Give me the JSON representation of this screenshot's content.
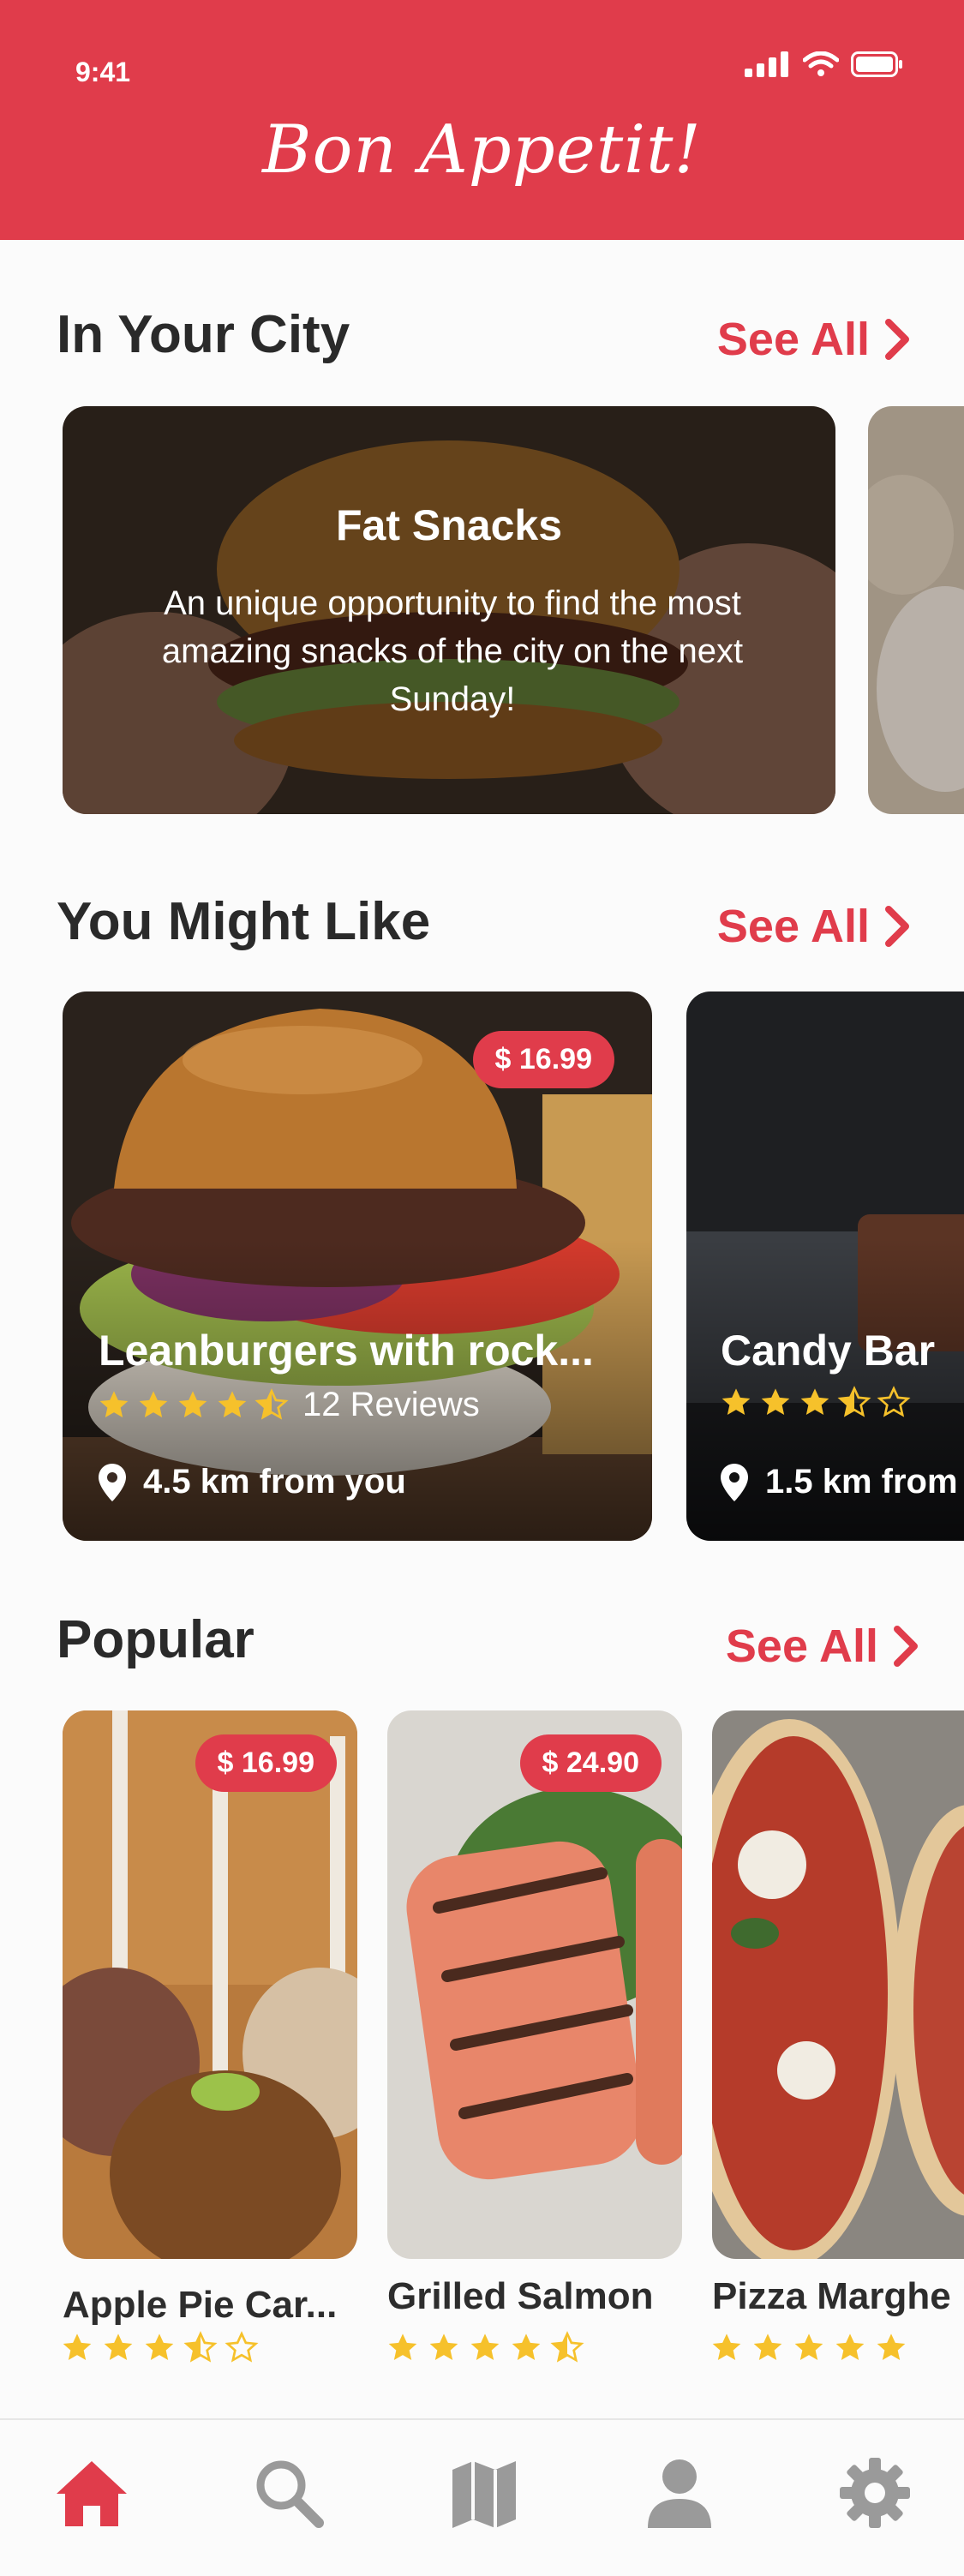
{
  "status": {
    "time": "9:41"
  },
  "app": {
    "brand": "Bon Appetit!",
    "accent": "#e03c4b"
  },
  "sections": {
    "city": {
      "title": "In Your City",
      "see_all": "See All"
    },
    "like": {
      "title": "You Might Like",
      "see_all": "See All"
    },
    "popular": {
      "title": "Popular",
      "see_all": "See All"
    }
  },
  "city_cards": [
    {
      "title": "Fat Snacks",
      "description": "An unique opportunity to find the most amazing snacks of the city on the next Sunday!"
    }
  ],
  "like_cards": [
    {
      "name": "Leanburgers with rock...",
      "price": "$ 16.99",
      "rating": 4.5,
      "reviews": "12 Reviews",
      "distance": "4.5 km from you"
    },
    {
      "name": "Candy Bar",
      "rating": 3.5,
      "distance": "1.5 km from"
    }
  ],
  "popular": [
    {
      "name": "Apple Pie Car...",
      "price": "$ 16.99",
      "rating": 3.5
    },
    {
      "name": "Grilled Salmon",
      "price": "$ 24.90",
      "rating": 4.5
    },
    {
      "name": "Pizza Marghe",
      "rating": 5
    }
  ],
  "tabs": [
    {
      "icon": "home-icon",
      "active": true
    },
    {
      "icon": "search-icon",
      "active": false
    },
    {
      "icon": "map-icon",
      "active": false
    },
    {
      "icon": "profile-icon",
      "active": false
    },
    {
      "icon": "settings-icon",
      "active": false
    }
  ]
}
